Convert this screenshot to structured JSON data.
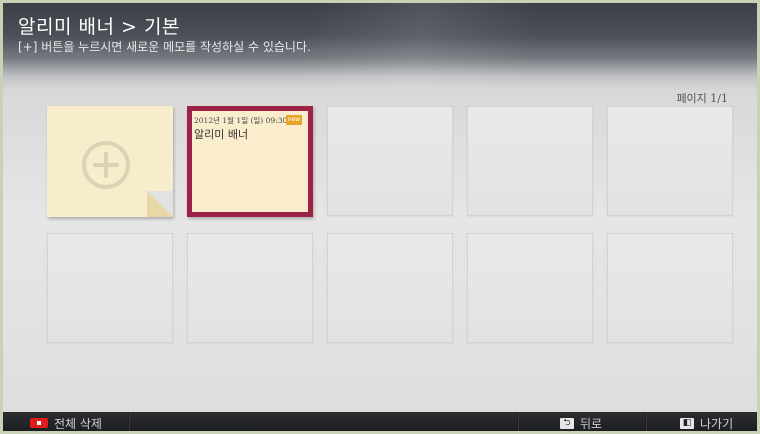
{
  "header": {
    "title": "알리미 배너 > 기본",
    "subtitle": "[+] 버튼을 누르시면 새로운 메모를 작성하실 수 있습니다."
  },
  "page_indicator": "페이지 1/1",
  "memos": [
    {
      "date": "2012년 1월 1일 (일) 09:30",
      "badge": "new",
      "text": "알리미 배너",
      "selected": true
    }
  ],
  "footer": {
    "delete_all": "전체 삭제",
    "back": "뒤로",
    "exit": "나가기"
  },
  "icons": {
    "add": "plus-circle-icon",
    "red_key": "red-key-icon",
    "back": "back-icon",
    "exit": "exit-icon"
  },
  "colors": {
    "selected_border": "#9c2345",
    "note_paper": "#f9edcd",
    "badge": "#e6a52a",
    "red_key": "#e11c1c"
  }
}
